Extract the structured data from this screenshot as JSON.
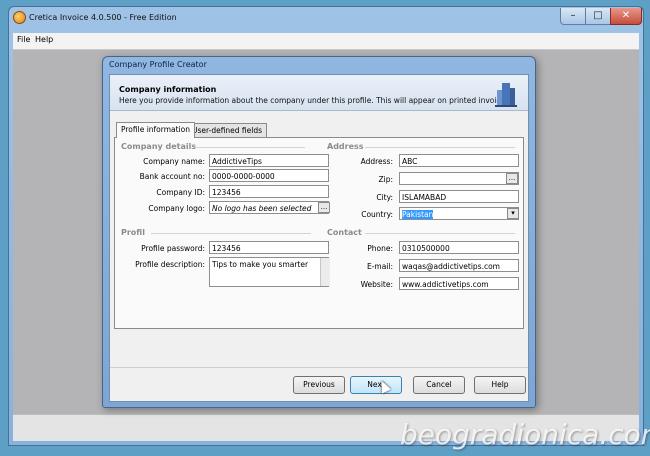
{
  "window": {
    "title": "Cretica Invoice 4.0.500 - Free Edition",
    "minimize": "–",
    "maximize": "□",
    "close": "✕"
  },
  "menu": {
    "file": "File",
    "help": "Help"
  },
  "dialog": {
    "title": "Company Profile Creator",
    "banner_title": "Company information",
    "banner_text": "Here you provide information about the company under this profile. This will appear on printed invoices.",
    "tabs": [
      "Profile information",
      "User-defined fields"
    ],
    "sections": {
      "company": "Company details",
      "address": "Address",
      "profile": "Profil",
      "contact": "Contact"
    },
    "labels": {
      "company_name": "Company name:",
      "bank_account": "Bank account no:",
      "company_id": "Company ID:",
      "company_logo": "Company logo:",
      "address": "Address:",
      "zip": "Zip:",
      "city": "City:",
      "country": "Country:",
      "profile_password": "Profile password:",
      "profile_description": "Profile description:",
      "phone": "Phone:",
      "email": "E-mail:",
      "website": "Website:"
    },
    "values": {
      "company_name": "AddictiveTips",
      "bank_account": "0000-0000-0000",
      "company_id": "123456",
      "company_logo": "No logo has been selected",
      "address": "ABC",
      "zip": "",
      "city": "ISLAMABAD",
      "country": "Pakistan",
      "profile_password": "123456",
      "profile_description": "Tips to make you smarter",
      "phone": "0310500000",
      "email": "waqas@addictivetips.com",
      "website": "www.addictivetips.com"
    },
    "buttons": {
      "previous": "Previous",
      "next": "Next",
      "cancel": "Cancel",
      "help": "Help",
      "browse": "..."
    }
  },
  "watermark": "beogradionica.com"
}
